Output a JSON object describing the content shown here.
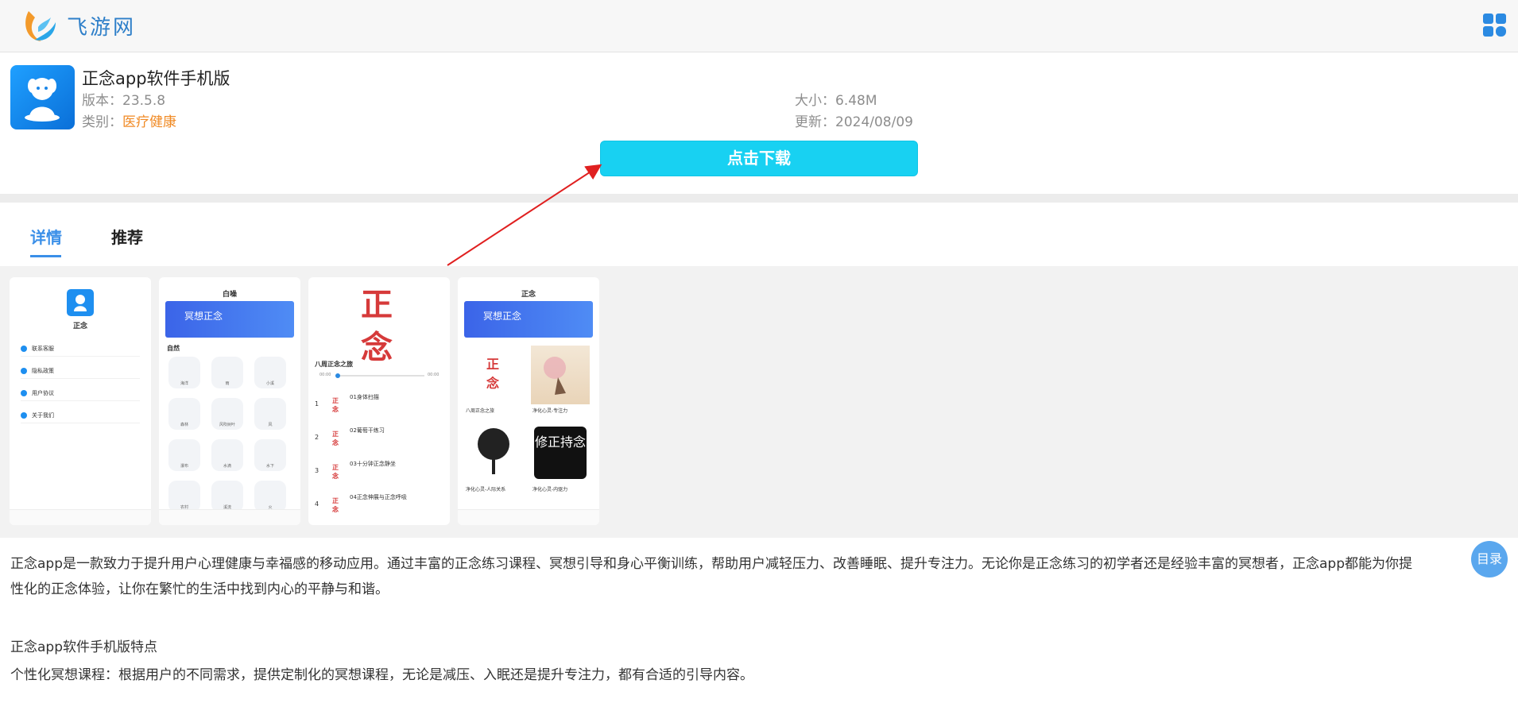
{
  "header": {
    "site_name": "飞游网",
    "logo_icon": "feiyou-logo-icon",
    "menu_icon": "grid-menu-icon",
    "brand_color": "#2e7fc9"
  },
  "app": {
    "title": "正念app软件手机版",
    "version_label": "版本：",
    "version": "23.5.8",
    "category_label": "类别：",
    "category": "医疗健康",
    "size_label": "大小：",
    "size": "6.48M",
    "update_label": "更新：",
    "update": "2024/08/09",
    "download_label": "点击下载",
    "download_color": "#18d1f2"
  },
  "tabs": [
    {
      "label": "详情",
      "active": true
    },
    {
      "label": "推荐",
      "active": false
    }
  ],
  "screenshots": {
    "shot1": {
      "app_name": "正念",
      "menu": [
        "联系客服",
        "隐私政策",
        "用户协议",
        "关于我们"
      ]
    },
    "shot2": {
      "title": "白噪",
      "banner": "冥想正念",
      "section": "自然",
      "tiles": [
        "海洋",
        "雨",
        "小溪",
        "森林",
        "风吹树叶",
        "风",
        "瀑布",
        "水滴",
        "水下",
        "农村",
        "溪流",
        "火"
      ]
    },
    "shot3": {
      "course": "八周正念之旅",
      "start_time": "00:00",
      "end_time": "00:00",
      "tracks": [
        "01身体扫描",
        "02葡萄干练习",
        "03十分钟正念静坐",
        "04正念伸展与正念呼吸"
      ]
    },
    "shot4": {
      "title": "正念",
      "banner": "冥想正念",
      "items": [
        "八周正念之旅",
        "净化心灵-专注力",
        "净化心灵-人际关系",
        "净化心灵-内驱力"
      ],
      "seal_text": "修正持念"
    }
  },
  "description": {
    "paragraph1_line1": "正念app是一款致力于提升用户心理健康与幸福感的移动应用。通过丰富的正念练习课程、冥想引导和身心平衡训练，帮助用户减轻压力、改善睡眠、提升专注力。无论你是正念练习的初学者还是经验丰富的冥想者，正念app都能为你提",
    "paragraph1_line2": "性化的正念体验，让你在繁忙的生活中找到内心的平静与和谐。",
    "features_title": "正念app软件手机版特点",
    "feature1": "个性化冥想课程：根据用户的不同需求，提供定制化的冥想课程，无论是减压、入眠还是提升专注力，都有合适的引导内容。"
  },
  "toc_label": "目录"
}
